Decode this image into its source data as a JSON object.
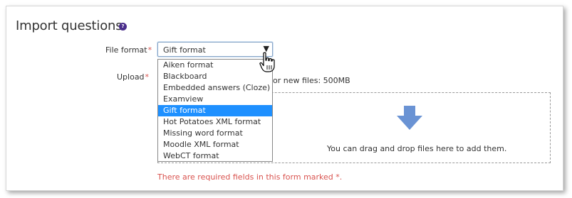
{
  "page": {
    "title": "Import questions",
    "help_icon": "question-circle-icon"
  },
  "form": {
    "file_format": {
      "label": "File format",
      "required_marker": "*",
      "selected": "Gift format",
      "arrow": "▼",
      "options": [
        "Aiken format",
        "Blackboard",
        "Embedded answers (Cloze)",
        "Examview",
        "Gift format",
        "Hot Potatoes XML format",
        "Missing word format",
        "Moodle XML format",
        "WebCT format"
      ],
      "highlighted_index": 4
    },
    "upload": {
      "label": "Upload",
      "required_marker": "*",
      "max_size_text": "or new files: 500MB",
      "drop_text": "You can drag and drop files here to add them.",
      "drop_icon": "down-arrow-icon"
    },
    "required_note": "There are required fields in this form marked *."
  },
  "colors": {
    "accent": "#1e90ff",
    "required": "#d9534f",
    "help_icon": "#4a2e8c",
    "drop_arrow": "#6a93d4"
  }
}
